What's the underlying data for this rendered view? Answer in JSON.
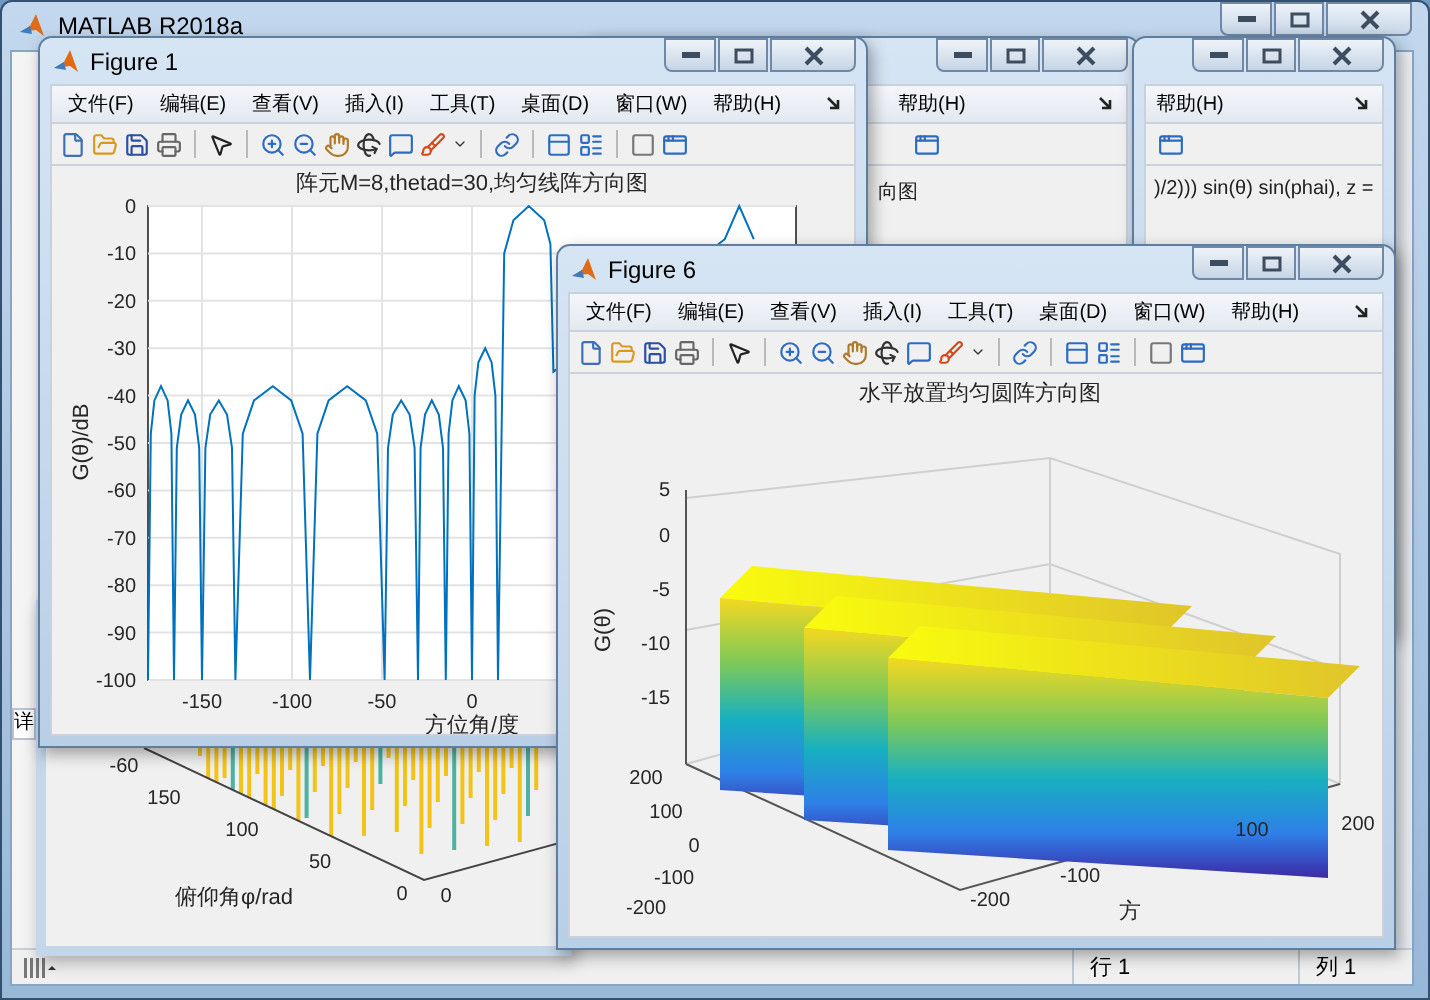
{
  "main_window": {
    "title": "MATLAB R2018a",
    "side_tab": "详",
    "status_bar": {
      "row": "行 1",
      "column": "列 1"
    }
  },
  "background_windows": [
    {
      "menu_item": "帮助(H)",
      "title_text": "向图"
    },
    {
      "menu_item": "帮助(H)",
      "title_text": ")/2))) sin(θ) sin(phai), z ="
    }
  ],
  "background_figure": {
    "xlabel": "俯仰角φ/rad",
    "ticks": [
      "-60",
      "150",
      "100",
      "50",
      "0",
      "0"
    ]
  },
  "figure_1": {
    "title": "Figure 1",
    "menu": [
      "文件(F)",
      "编辑(E)",
      "查看(V)",
      "插入(I)",
      "工具(T)",
      "桌面(D)",
      "窗口(W)",
      "帮助(H)"
    ],
    "chart_data": {
      "type": "line",
      "title": "阵元M=8,thetad=30,均匀线阵方向图",
      "xlabel": "方位角/度",
      "ylabel": "G(θ)/dB",
      "x": [
        -180,
        -178.5,
        -176.4,
        -172.8,
        -169.1,
        -167,
        -165.5,
        -164,
        -161.6,
        -157.8,
        -153.9,
        -151.6,
        -150,
        -148.1,
        -145.4,
        -140.7,
        -136.1,
        -133.3,
        -131.4,
        -127.3,
        -121.1,
        -110.7,
        -100.4,
        -94.1,
        -90,
        -85.9,
        -79.7,
        -69.3,
        -59,
        -52.7,
        -48.6,
        -46.7,
        -44,
        -39.3,
        -34.7,
        -31.9,
        -30,
        -28.5,
        -26.1,
        -22.3,
        -18.4,
        -16.1,
        -14.5,
        -13,
        -10.9,
        -7.3,
        -3.6,
        -1.5,
        0,
        1.5,
        3.6,
        7.3,
        10.9,
        13,
        14.5,
        17.9,
        23,
        31.6,
        40.1,
        43.5,
        45.2,
        140.5,
        148.5,
        156.5
      ],
      "series": [
        {
          "color": "#0072bd",
          "values": [
            -100,
            -48,
            -41,
            -38,
            -41,
            -48,
            -100,
            -51,
            -44,
            -41,
            -44,
            -51,
            -100,
            -51,
            -44,
            -41,
            -44,
            -51,
            -100,
            -48,
            -41,
            -38,
            -41,
            -48,
            -100,
            -48,
            -41,
            -38,
            -41,
            -48,
            -100,
            -51,
            -44,
            -41,
            -44,
            -51,
            -100,
            -51,
            -44,
            -41,
            -44,
            -51,
            -100,
            -48,
            -41,
            -38,
            -41,
            -48,
            -100,
            -40,
            -33,
            -30,
            -33,
            -40,
            -100,
            -10,
            -3,
            0,
            -3,
            -8,
            -35,
            -7,
            0,
            -7
          ]
        }
      ],
      "grid": true,
      "xlim": [
        -180,
        180
      ],
      "ylim": [
        -100,
        0
      ],
      "xticks": [
        -150,
        -100,
        -50,
        0
      ],
      "yticks": [
        0,
        -10,
        -20,
        -30,
        -40,
        -50,
        -60,
        -70,
        -80,
        -90,
        -100
      ]
    }
  },
  "figure_6": {
    "title": "Figure 6",
    "menu": [
      "文件(F)",
      "编辑(E)",
      "查看(V)",
      "插入(I)",
      "工具(T)",
      "桌面(D)",
      "窗口(W)",
      "帮助(H)"
    ],
    "plot": {
      "title": "水平放置均匀圆阵方向图",
      "zlabel": "G(θ)",
      "zticks": [
        "5",
        "0",
        "-5",
        "-10",
        "-15"
      ],
      "left_axis_ticks": [
        "200",
        "100",
        "0",
        "-100",
        "-200"
      ],
      "right_axis_ticks": [
        "-200",
        "-100",
        "100",
        "200"
      ],
      "xlabel": "方"
    }
  }
}
